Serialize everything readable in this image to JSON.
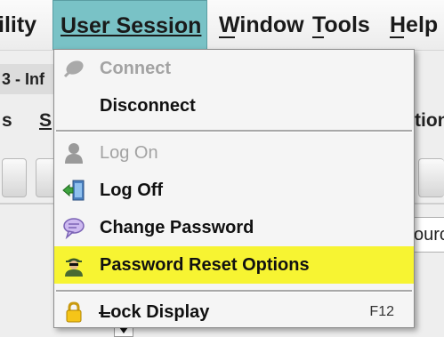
{
  "menubar": {
    "utility_label": "ility",
    "user_session_label": "User Session",
    "window_label": "Window",
    "tools_label": "Tools",
    "help_label": "Help"
  },
  "background": {
    "window_title_fragment": "3 - Inf",
    "menu_fragment_1": "s",
    "menu_fragment_2": "S",
    "menu_fragment_right": "tion",
    "panel_fragment": "ourc"
  },
  "dropdown": {
    "items": [
      {
        "label": "Connect",
        "enabled": false,
        "icon": "leaf-icon"
      },
      {
        "label": "Disconnect",
        "enabled": true,
        "icon": ""
      },
      {
        "label": "Log On",
        "enabled": false,
        "icon": "user-silhouette-icon"
      },
      {
        "label": "Log Off",
        "enabled": true,
        "icon": "exit-door-icon"
      },
      {
        "label": "Change Password",
        "enabled": true,
        "icon": "speech-bubble-icon"
      },
      {
        "label": "Password Reset Options",
        "enabled": true,
        "icon": "agent-icon",
        "highlighted": true,
        "highlight_color": "#f7f432"
      },
      {
        "label": "Lock Display",
        "enabled": true,
        "icon": "padlock-icon",
        "shortcut": "F12"
      }
    ]
  },
  "colors": {
    "active_menu_bg": "#79c2c6",
    "highlight": "#f7f432",
    "disabled_text": "#a3a3a3"
  }
}
